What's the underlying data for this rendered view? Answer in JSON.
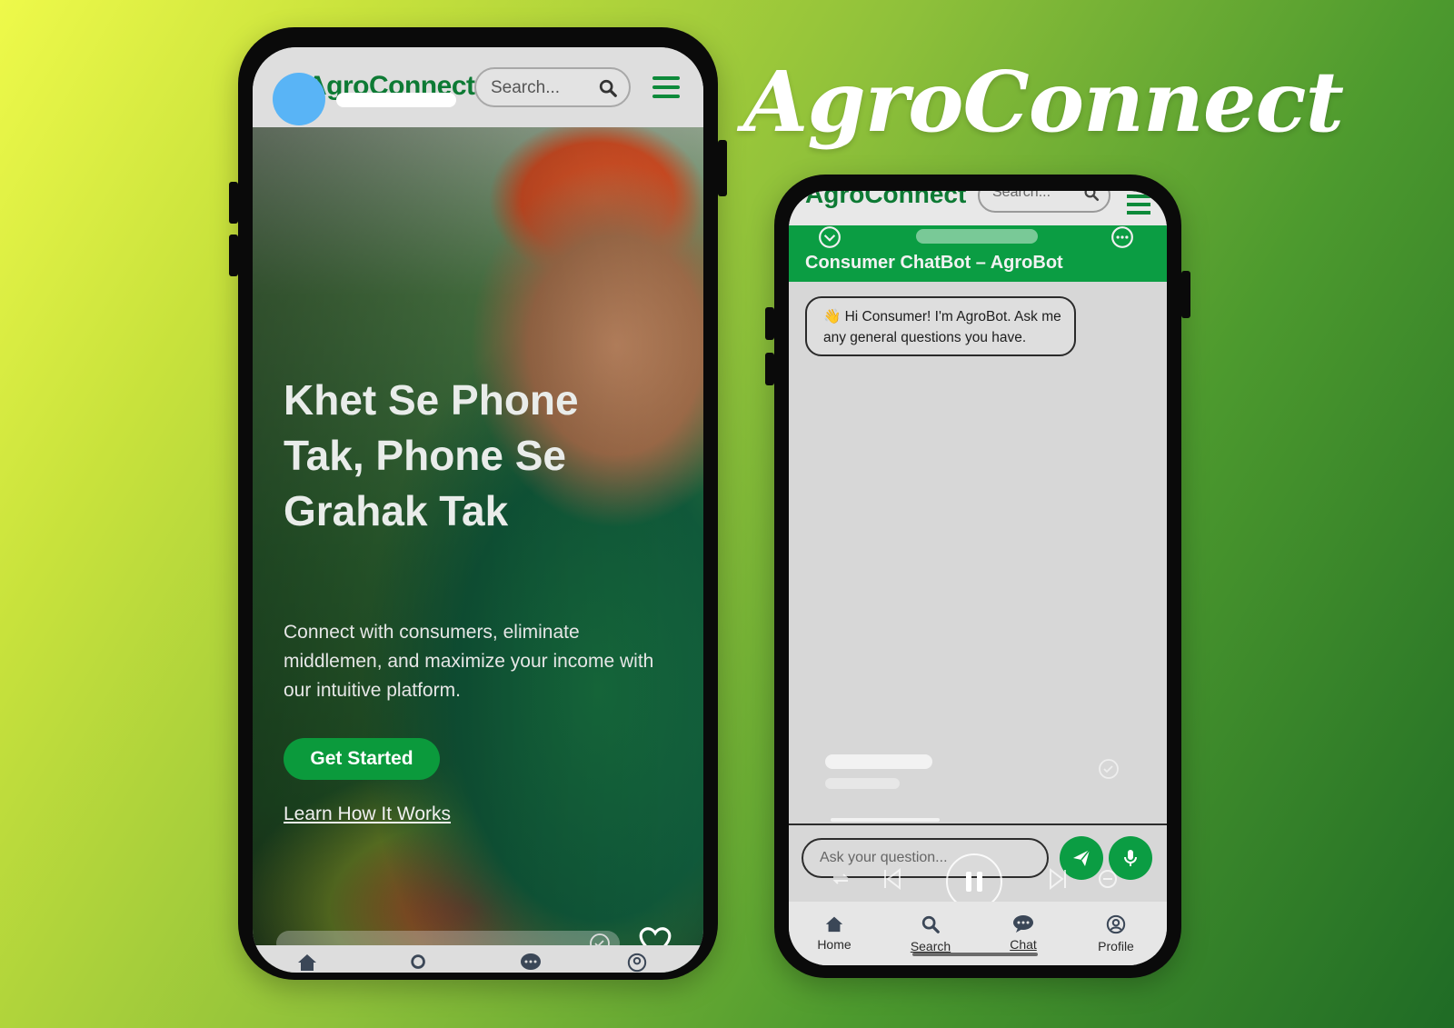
{
  "brand": {
    "title": "AgroConnect"
  },
  "left_phone": {
    "header": {
      "logo": "AgroConnect",
      "search_placeholder": "Search..."
    },
    "hero": {
      "title": "Khet Se Phone Tak, Phone Se Grahak Tak",
      "subtitle": "Connect with consumers, eliminate middlemen, and maximize your income with our intuitive platform.",
      "cta_primary": "Get Started",
      "cta_secondary": "Learn How It Works"
    },
    "bottom_nav_icons": [
      "home-icon",
      "search-icon",
      "chat-icon",
      "profile-icon"
    ]
  },
  "right_phone": {
    "header": {
      "logo": "AgroConnect",
      "search_placeholder": "Search..."
    },
    "chat": {
      "title": "Consumer ChatBot – AgroBot",
      "greeting": "👋 Hi Consumer! I'm AgroBot. Ask me any general questions you have.",
      "input_placeholder": "Ask your question..."
    },
    "bottom_nav": [
      {
        "label": "Home",
        "icon": "home-icon"
      },
      {
        "label": "Search",
        "icon": "search-icon"
      },
      {
        "label": "Chat",
        "icon": "chat-icon"
      },
      {
        "label": "Profile",
        "icon": "profile-icon"
      }
    ]
  },
  "colors": {
    "brand_green": "#0b9d43",
    "logo_green": "#0d7a34",
    "overlay_blue_dot": "#59b4f6"
  }
}
